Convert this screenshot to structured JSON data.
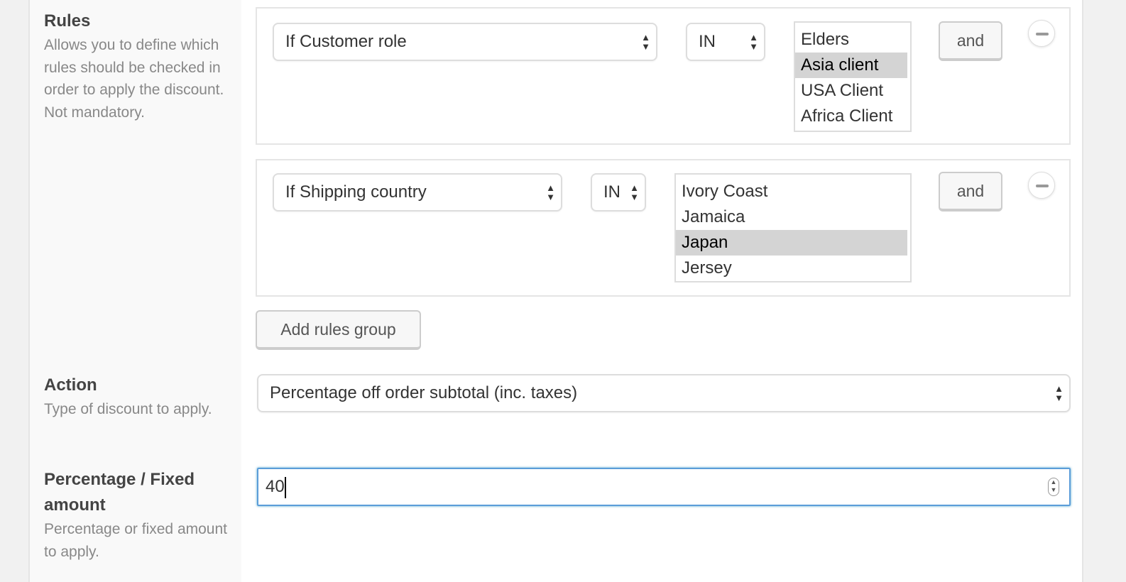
{
  "rules": {
    "title": "Rules",
    "description": "Allows you to define which rules should be checked in order to apply the discount. Not mandatory.",
    "groups": [
      {
        "condition": "If Customer role",
        "operator": "IN",
        "options": [
          "Elders",
          "Asia client",
          "USA Client",
          "Africa Client"
        ],
        "selected": "Asia client",
        "and_label": "and"
      },
      {
        "condition": "If Shipping country",
        "operator": "IN",
        "options": [
          "Ivory Coast",
          "Jamaica",
          "Japan",
          "Jersey"
        ],
        "selected": "Japan",
        "and_label": "and"
      }
    ],
    "add_group_label": "Add rules group"
  },
  "action": {
    "title": "Action",
    "description": "Type of discount to apply.",
    "value": "Percentage off order subtotal (inc. taxes)"
  },
  "amount": {
    "title": "Percentage / Fixed amount",
    "description": "Percentage or fixed amount to apply.",
    "value": "40"
  },
  "colors": {
    "selected_option": "#d4d4d4",
    "focus_border": "#5b9dd9"
  }
}
